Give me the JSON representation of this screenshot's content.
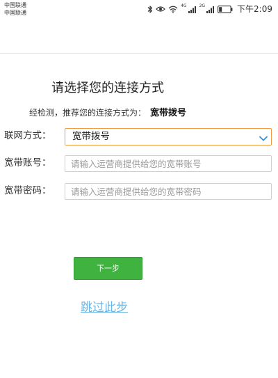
{
  "status_bar": {
    "carrier_1": "中国联通",
    "carrier_2": "中国联通",
    "net_1": "4G",
    "net_2": "2G",
    "time": "下午2:09",
    "icons": [
      "bluetooth-icon",
      "eye-icon",
      "wifi-icon",
      "signal-icon",
      "signal-icon",
      "battery-icon"
    ]
  },
  "main": {
    "title": "请选择您的连接方式",
    "recommend_prefix": "经检测，推荐您的连接方式为：",
    "recommend_value": "宽带拨号"
  },
  "form": {
    "connection_label": "联网方式：",
    "connection_value": "宽带拨号",
    "account_label": "宽带账号：",
    "account_placeholder": "请输入运营商提供给您的宽带账号",
    "account_value": "",
    "password_label": "宽带密码：",
    "password_placeholder": "请输入运营商提供给您的宽带密码",
    "password_value": ""
  },
  "actions": {
    "next_label": "下一步",
    "skip_label": "跳过此步"
  },
  "colors": {
    "accent_button": "#3fb23f",
    "select_border": "#f09a44",
    "chevron": "#3b8fd6",
    "link": "#68b5e6"
  }
}
